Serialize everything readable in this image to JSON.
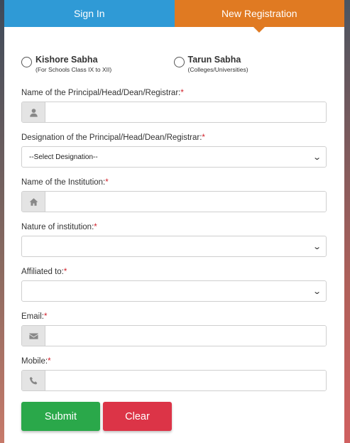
{
  "tabs": {
    "signin": "Sign In",
    "register": "New Registration"
  },
  "radios": [
    {
      "title": "Kishore Sabha",
      "sub": "(For Schools Class IX to XII)"
    },
    {
      "title": "Tarun Sabha",
      "sub": "(Colleges/Universities)"
    }
  ],
  "fields": {
    "principal_name": "Name of the Principal/Head/Dean/Registrar:",
    "designation": "Designation of the Principal/Head/Dean/Registrar:",
    "designation_selected": "--Select Designation--",
    "institution_name": "Name of the Institution:",
    "nature": "Nature of institution:",
    "nature_selected": "",
    "affiliated": "Affiliated to:",
    "affiliated_selected": "",
    "email": "Email:",
    "mobile": "Mobile:",
    "required_mark": "*"
  },
  "buttons": {
    "submit": "Submit",
    "clear": "Clear"
  },
  "colors": {
    "signin_tab": "#2f9ad6",
    "register_tab": "#e07a22",
    "submit": "#2aa84a",
    "clear": "#dc3447",
    "required": "#d0202a"
  },
  "icons": {
    "principal": "user-icon",
    "institution": "home-icon",
    "email": "envelope-icon",
    "mobile": "phone-icon"
  }
}
